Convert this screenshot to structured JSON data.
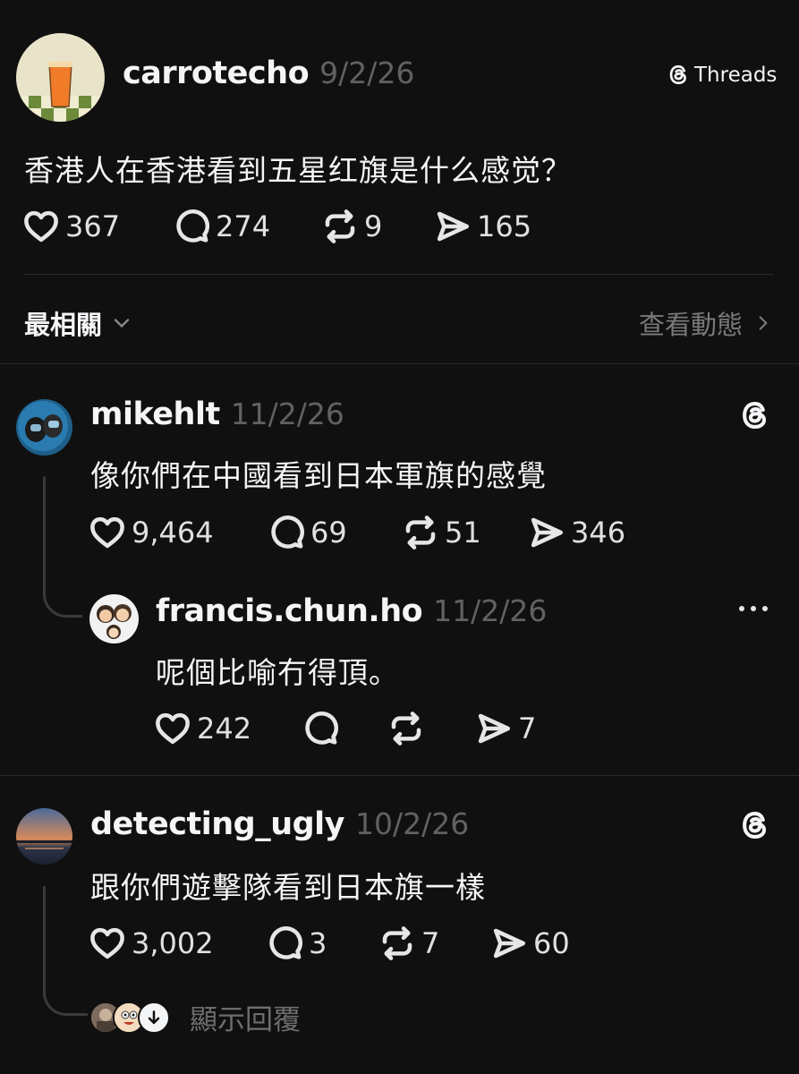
{
  "post": {
    "username": "carrotecho",
    "date": "9/2/26",
    "platform_label": "Threads",
    "text": "香港人在香港看到五星红旗是什么感觉？",
    "likes": "367",
    "comments": "274",
    "reposts": "9",
    "shares": "165"
  },
  "sort_bar": {
    "sort_label": "最相關",
    "activity_label": "查看動態"
  },
  "replies": [
    {
      "username": "mikehlt",
      "date": "11/2/26",
      "text": "像你們在中國看到日本軍旗的感覺",
      "likes": "9,464",
      "comments": "69",
      "reposts": "51",
      "shares": "346"
    },
    {
      "username": "francis.chun.ho",
      "date": "11/2/26",
      "text": "呢個比喻冇得頂。",
      "likes": "242",
      "comments": "",
      "reposts": "",
      "shares": "7"
    },
    {
      "username": "detecting_ugly",
      "date": "10/2/26",
      "text": "跟你們遊擊隊看到日本旗一樣",
      "likes": "3,002",
      "comments": "3",
      "reposts": "7",
      "shares": "60",
      "show_replies_label": "顯示回覆"
    }
  ],
  "colors": {
    "background": "#101010",
    "text": "#f3f5f7",
    "muted": "#616161",
    "divider": "#2a2a2a"
  }
}
